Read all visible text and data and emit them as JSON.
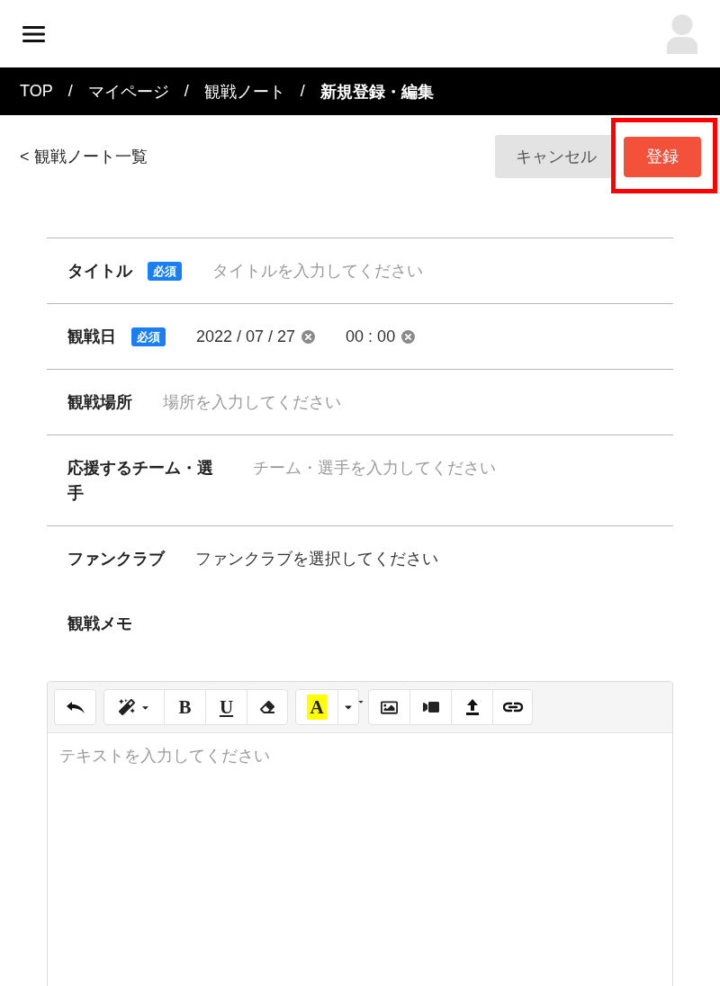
{
  "breadcrumb": [
    {
      "kind": "link",
      "label": "TOP"
    },
    {
      "kind": "separator",
      "label": "/"
    },
    {
      "kind": "link",
      "label": "マイページ"
    },
    {
      "kind": "separator",
      "label": "/"
    },
    {
      "kind": "link",
      "label": "観戦ノート"
    },
    {
      "kind": "separator",
      "label": "/"
    },
    {
      "kind": "current",
      "label": "新規登録・編集"
    }
  ],
  "back_link": {
    "label": "< 観戦ノート一覧"
  },
  "actions": [
    {
      "kind": "cancel",
      "label": "キャンセル",
      "highlighted": false
    },
    {
      "kind": "submit",
      "label": "登録",
      "highlighted": true
    }
  ],
  "form": {
    "fields": [
      {
        "kind": "text",
        "label": "タイトル",
        "required_badge": "必須",
        "placeholder": "タイトルを入力してください"
      },
      {
        "kind": "datetime",
        "label": "観戦日",
        "required_badge": "必須",
        "date": "2022 / 07 / 27",
        "time": "00 : 00"
      },
      {
        "kind": "text",
        "label": "観戦場所",
        "placeholder": "場所を入力してください"
      },
      {
        "kind": "text",
        "label": "応援するチーム・選手",
        "placeholder": "チーム・選手を入力してください"
      },
      {
        "kind": "select",
        "label": "ファンクラブ",
        "value": "ファンクラブを選択してください"
      },
      {
        "kind": "heading",
        "label": "観戦メモ"
      }
    ]
  },
  "editor": {
    "toolbar": [
      [
        {
          "kind": "undo"
        }
      ],
      [
        {
          "kind": "style"
        },
        {
          "kind": "bold",
          "label": "B"
        },
        {
          "kind": "underline",
          "label": "U"
        },
        {
          "kind": "eraser"
        }
      ],
      [
        {
          "kind": "highlight",
          "label": "A"
        },
        {
          "kind": "color_caret"
        },
        {
          "kind": "overflow_caret"
        }
      ],
      [
        {
          "kind": "picture"
        },
        {
          "kind": "video"
        },
        {
          "kind": "upload"
        },
        {
          "kind": "link"
        }
      ]
    ],
    "placeholder": "テキストを入力してください"
  }
}
